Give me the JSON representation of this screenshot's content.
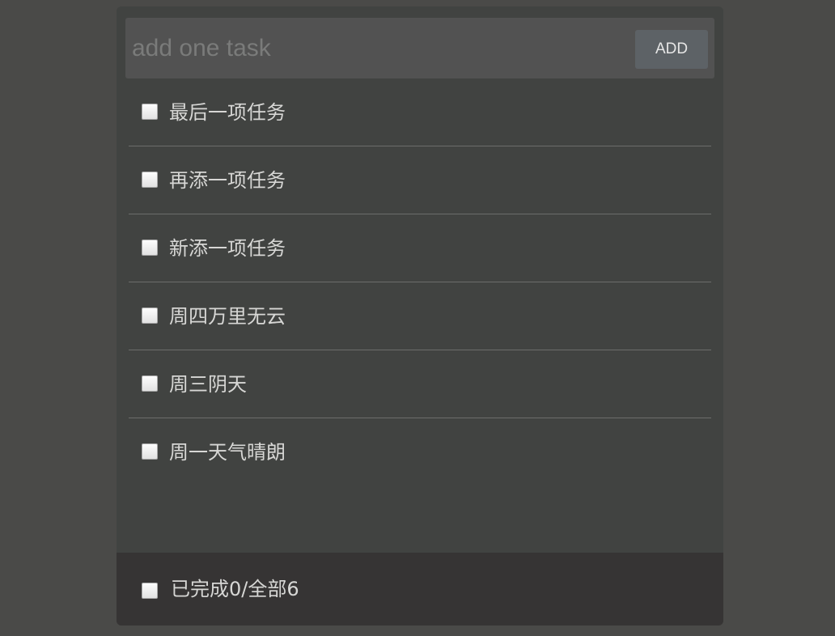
{
  "header": {
    "input_value": "",
    "input_placeholder": "add one task",
    "add_label": "ADD"
  },
  "tasks": [
    {
      "label": "最后一项任务",
      "done": false
    },
    {
      "label": "再添一项任务",
      "done": false
    },
    {
      "label": "新添一项任务",
      "done": false
    },
    {
      "label": "周四万里无云",
      "done": false
    },
    {
      "label": "周三阴天",
      "done": false
    },
    {
      "label": "周一天气晴朗",
      "done": false
    }
  ],
  "footer": {
    "summary": "已完成0/全部6",
    "select_all": false
  }
}
